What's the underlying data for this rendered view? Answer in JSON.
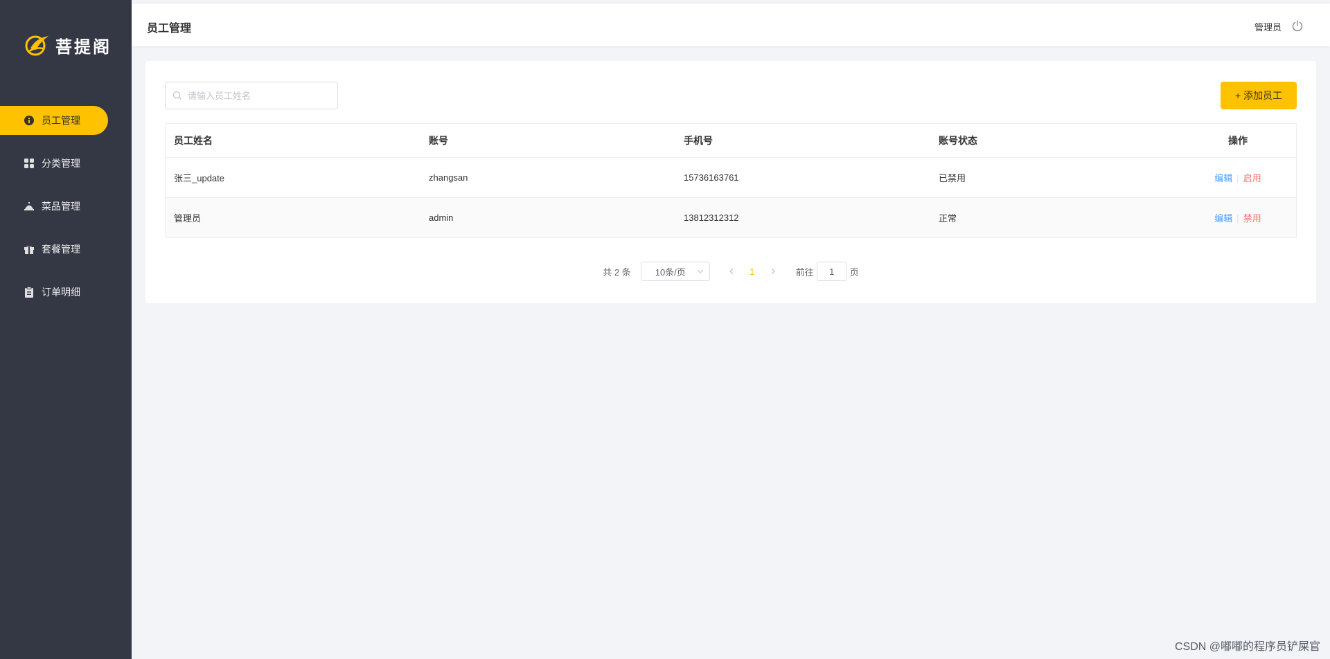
{
  "brand": {
    "name": "菩提阁",
    "accent": "#ffc200",
    "sidebar_bg": "#343744"
  },
  "sidebar": {
    "items": [
      {
        "label": "员工管理",
        "icon": "info-circle-icon",
        "active": true
      },
      {
        "label": "分类管理",
        "icon": "grid-icon",
        "active": false
      },
      {
        "label": "菜品管理",
        "icon": "food-cover-icon",
        "active": false
      },
      {
        "label": "套餐管理",
        "icon": "gift-icon",
        "active": false
      },
      {
        "label": "订单明细",
        "icon": "clipboard-icon",
        "active": false
      }
    ]
  },
  "header": {
    "title": "员工管理",
    "user": "管理员",
    "logout_icon": "power-icon"
  },
  "toolbar": {
    "search_placeholder": "请输入员工姓名",
    "add_label": "+ 添加员工"
  },
  "table": {
    "columns": [
      "员工姓名",
      "账号",
      "手机号",
      "账号状态",
      "操作"
    ],
    "rows": [
      {
        "name": "张三_update",
        "account": "zhangsan",
        "phone": "15736163761",
        "status": "已禁用",
        "edit": "编辑",
        "toggle": "启用"
      },
      {
        "name": "管理员",
        "account": "admin",
        "phone": "13812312312",
        "status": "正常",
        "edit": "编辑",
        "toggle": "禁用"
      }
    ]
  },
  "pagination": {
    "total": "共 2 条",
    "page_size": "10条/页",
    "current_page": "1",
    "goto_label": "前往",
    "goto_value": "1",
    "page_suffix": "页"
  },
  "watermark": "CSDN @嘟嘟的程序员铲屎官"
}
